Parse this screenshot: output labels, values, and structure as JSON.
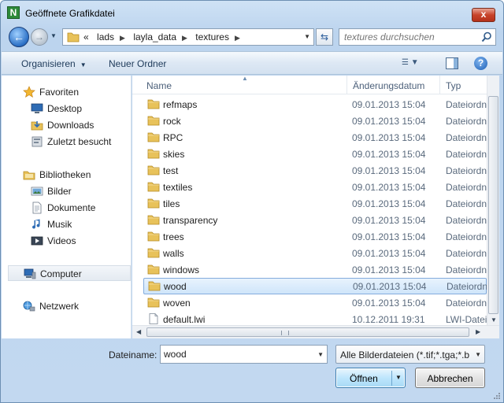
{
  "window": {
    "title": "Geöffnete Grafikdatei",
    "app_icon_letter": "N",
    "close_label": "x"
  },
  "address": {
    "crumbs": [
      "«",
      "lads",
      "layla_data",
      "textures"
    ],
    "search_placeholder": "textures durchsuchen"
  },
  "toolbar": {
    "organize_label": "Organisieren",
    "new_folder_label": "Neuer Ordner"
  },
  "nav": {
    "favorites": {
      "label": "Favoriten",
      "icon": "star-icon",
      "items": [
        {
          "label": "Desktop",
          "icon": "desktop-icon"
        },
        {
          "label": "Downloads",
          "icon": "downloads-icon"
        },
        {
          "label": "Zuletzt besucht",
          "icon": "recent-places-icon"
        }
      ]
    },
    "libraries": {
      "label": "Bibliotheken",
      "icon": "libraries-icon",
      "items": [
        {
          "label": "Bilder",
          "icon": "pictures-icon"
        },
        {
          "label": "Dokumente",
          "icon": "documents-icon"
        },
        {
          "label": "Musik",
          "icon": "music-icon"
        },
        {
          "label": "Videos",
          "icon": "videos-icon"
        }
      ]
    },
    "computer": {
      "label": "Computer",
      "icon": "computer-icon"
    },
    "network": {
      "label": "Netzwerk",
      "icon": "network-icon"
    }
  },
  "files": {
    "columns": {
      "name": "Name",
      "date": "Änderungsdatum",
      "type": "Typ"
    },
    "rows": [
      {
        "name": "refmaps",
        "date": "09.01.2013 15:04",
        "type": "Dateiordner",
        "kind": "folder"
      },
      {
        "name": "rock",
        "date": "09.01.2013 15:04",
        "type": "Dateiordner",
        "kind": "folder"
      },
      {
        "name": "RPC",
        "date": "09.01.2013 15:04",
        "type": "Dateiordner",
        "kind": "folder"
      },
      {
        "name": "skies",
        "date": "09.01.2013 15:04",
        "type": "Dateiordner",
        "kind": "folder"
      },
      {
        "name": "test",
        "date": "09.01.2013 15:04",
        "type": "Dateiordner",
        "kind": "folder"
      },
      {
        "name": "textiles",
        "date": "09.01.2013 15:04",
        "type": "Dateiordner",
        "kind": "folder"
      },
      {
        "name": "tiles",
        "date": "09.01.2013 15:04",
        "type": "Dateiordner",
        "kind": "folder"
      },
      {
        "name": "transparency",
        "date": "09.01.2013 15:04",
        "type": "Dateiordner",
        "kind": "folder"
      },
      {
        "name": "trees",
        "date": "09.01.2013 15:04",
        "type": "Dateiordner",
        "kind": "folder"
      },
      {
        "name": "walls",
        "date": "09.01.2013 15:04",
        "type": "Dateiordner",
        "kind": "folder"
      },
      {
        "name": "windows",
        "date": "09.01.2013 15:04",
        "type": "Dateiordner",
        "kind": "folder"
      },
      {
        "name": "wood",
        "date": "09.01.2013 15:04",
        "type": "Dateiordner",
        "kind": "folder",
        "selected": true
      },
      {
        "name": "woven",
        "date": "09.01.2013 15:04",
        "type": "Dateiordner",
        "kind": "folder"
      },
      {
        "name": "default.lwi",
        "date": "10.12.2011 19:31",
        "type": "LWI-Datei",
        "kind": "file"
      }
    ]
  },
  "bottom": {
    "filename_label": "Dateiname:",
    "filename_value": "wood",
    "filter_value": "Alle Bilderdateien (*.tif;*.tga;*.b",
    "open_label": "Öffnen",
    "cancel_label": "Abbrechen"
  },
  "colors": {
    "selection_border": "#84acdd",
    "selection_fill": "#cfe5fa",
    "folder": "#e8c25a"
  }
}
